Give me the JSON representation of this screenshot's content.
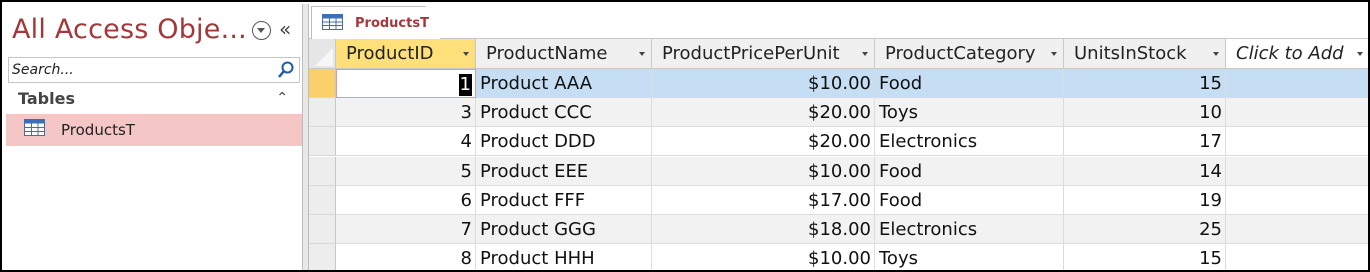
{
  "nav": {
    "title": "All Access Obje...",
    "collapse_glyph": "«",
    "search_placeholder": "Search...",
    "group_label": "Tables",
    "group_chevron": "«",
    "items": [
      {
        "label": "ProductsT",
        "icon": "table-icon"
      }
    ]
  },
  "tab": {
    "label": "ProductsT",
    "icon": "table-icon"
  },
  "columns": [
    {
      "label": "ProductID",
      "align": "num"
    },
    {
      "label": "ProductName",
      "align": "txt"
    },
    {
      "label": "ProductPricePerUnit",
      "align": "num"
    },
    {
      "label": "ProductCategory",
      "align": "txt"
    },
    {
      "label": "UnitsInStock",
      "align": "num"
    },
    {
      "label": "Click to Add",
      "align": "txt"
    }
  ],
  "rows": [
    [
      "1",
      "Product AAA",
      "$10.00",
      "Food",
      "15",
      ""
    ],
    [
      "3",
      "Product CCC",
      "$20.00",
      "Toys",
      "10",
      ""
    ],
    [
      "4",
      "Product DDD",
      "$20.00",
      "Electronics",
      "17",
      ""
    ],
    [
      "5",
      "Product EEE",
      "$10.00",
      "Food",
      "14",
      ""
    ],
    [
      "6",
      "Product FFF",
      "$17.00",
      "Food",
      "19",
      ""
    ],
    [
      "7",
      "Product GGG",
      "$18.00",
      "Electronics",
      "25",
      ""
    ],
    [
      "8",
      "Product HHH",
      "$10.00",
      "Toys",
      "15",
      ""
    ]
  ],
  "selected_row": 0,
  "colors": {
    "accent": "#a4373a",
    "nav_item_selected": "#f4c6c6",
    "header_active": "#fde07a",
    "row_selected": "#c6def3"
  }
}
